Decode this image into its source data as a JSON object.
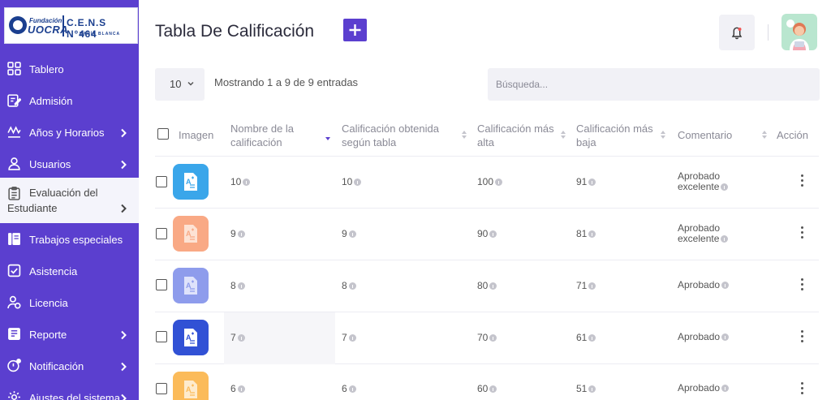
{
  "logo": {
    "fundacion": "Fundación",
    "uocra": "UOCRA",
    "cens": "C.E.N.S N°464",
    "city": "BAHÍA BLANCA"
  },
  "sidebar": {
    "items": [
      {
        "label": "Tablero",
        "icon": "dashboard-icon"
      },
      {
        "label": "Admisión",
        "icon": "edit-icon"
      },
      {
        "label": "Años y Horarios",
        "icon": "schedule-icon"
      },
      {
        "label": "Usuarios",
        "icon": "user-icon"
      },
      {
        "label": "Evaluación del",
        "label2": "Estudiante",
        "icon": "clipboard-icon"
      },
      {
        "label": "Trabajos especiales",
        "icon": "book-icon"
      },
      {
        "label": "Asistencia",
        "icon": "checkbox-icon"
      },
      {
        "label": "Licencia",
        "icon": "user-license-icon"
      },
      {
        "label": "Reporte",
        "icon": "report-icon"
      },
      {
        "label": "Notificación",
        "icon": "notification-icon"
      },
      {
        "label": "Ajustes del sistema",
        "icon": "settings-icon"
      }
    ]
  },
  "header": {
    "title": "Tabla De Calificación"
  },
  "controls": {
    "page_length": "10",
    "showing": "Mostrando 1 a 9 de 9 entradas",
    "search_placeholder": "Búsqueda..."
  },
  "table": {
    "columns": {
      "image": "Imagen",
      "name": [
        "Nombre de la",
        "calificación"
      ],
      "obtained": [
        "Calificación obtenida",
        "según tabla"
      ],
      "highest": [
        "Calificación más",
        "alta"
      ],
      "lowest": [
        "Calificación más",
        "baja"
      ],
      "comment": "Comentario",
      "action": "Acción"
    },
    "rows": [
      {
        "name": "10",
        "obtained": "10",
        "highest": "100",
        "lowest": "91",
        "comment1": "Aprobado",
        "comment2": "excelente",
        "color": "#3aa6ea"
      },
      {
        "name": "9",
        "obtained": "9",
        "highest": "90",
        "lowest": "81",
        "comment1": "Aprobado",
        "comment2": "excelente",
        "color": "#f9a985"
      },
      {
        "name": "8",
        "obtained": "8",
        "highest": "80",
        "lowest": "71",
        "comment1": "Aprobado",
        "comment2": "",
        "color": "#8e9cec"
      },
      {
        "name": "7",
        "obtained": "7",
        "highest": "70",
        "lowest": "61",
        "comment1": "Aprobado",
        "comment2": "",
        "color": "#3151d5"
      },
      {
        "name": "6",
        "obtained": "6",
        "highest": "60",
        "lowest": "51",
        "comment1": "Aprobado",
        "comment2": "",
        "color": "#fbbb5a"
      }
    ]
  },
  "colors": {
    "accent": "#5b3fcf",
    "sidebar_active_bg": "#f4f4fb"
  }
}
